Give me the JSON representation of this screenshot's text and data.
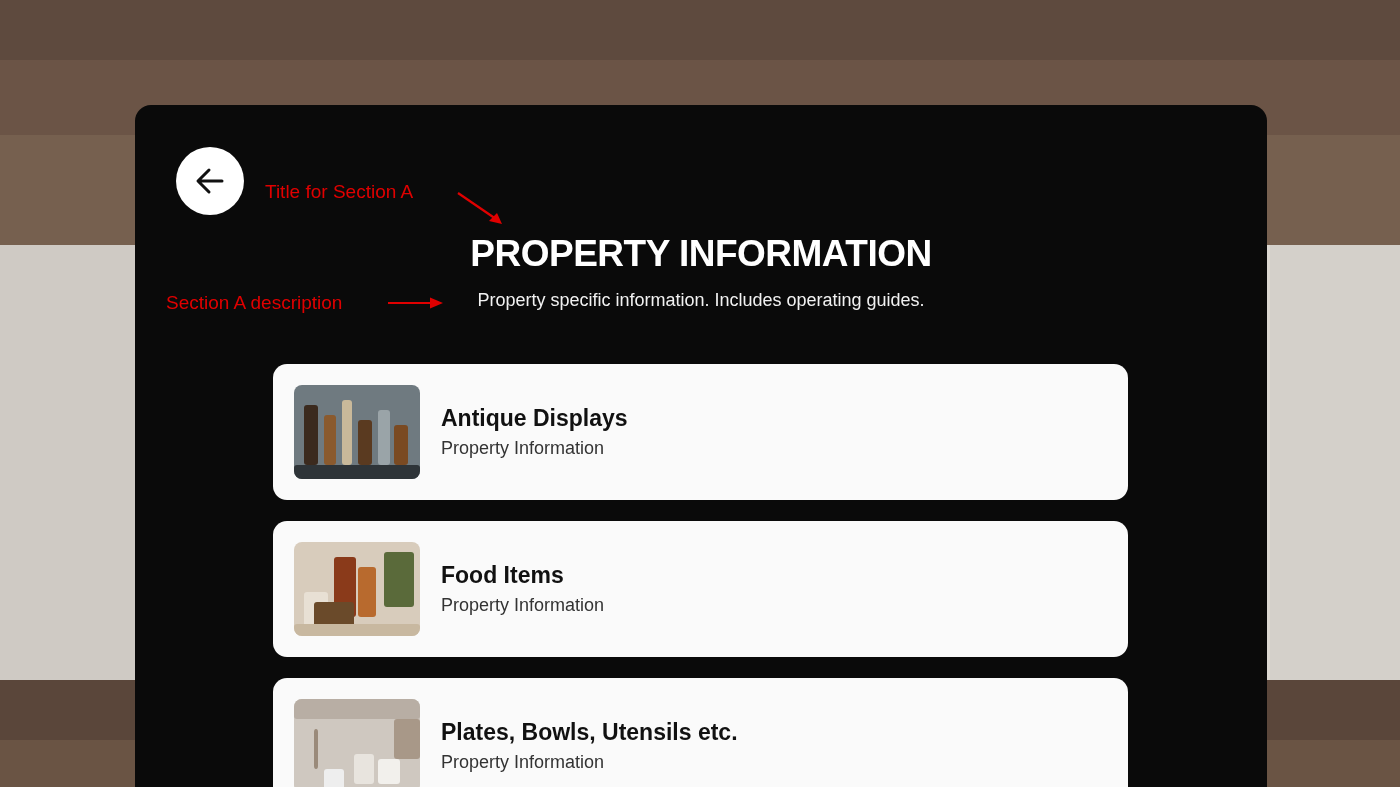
{
  "title": {
    "text": "PROPERTY INFORMATION",
    "annotation": "Title for Section A"
  },
  "description": {
    "text": "Property specific information. Includes operating guides.",
    "annotation": "Section A description"
  },
  "cards": [
    {
      "title": "Antique Displays",
      "subtitle": "Property Information"
    },
    {
      "title": "Food Items",
      "subtitle": "Property Information"
    },
    {
      "title": "Plates, Bowls, Utensils etc.",
      "subtitle": "Property Information"
    }
  ]
}
